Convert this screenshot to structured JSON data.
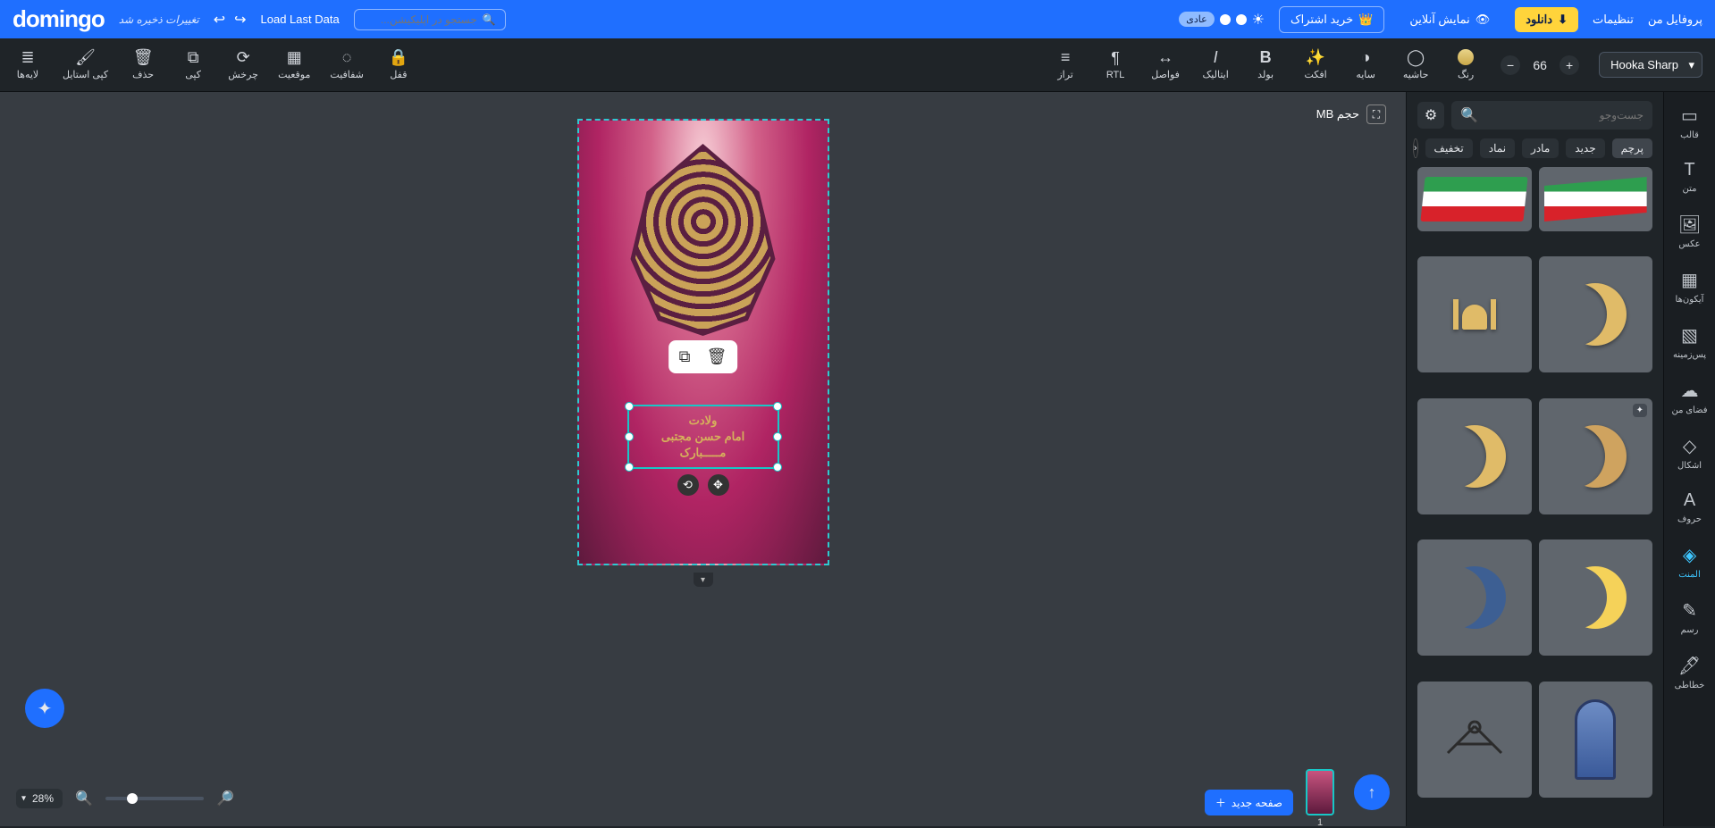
{
  "topbar": {
    "logo": "domingo",
    "profile": "پروفایل من",
    "settings": "تنظیمات",
    "download": "دانلود",
    "preview": "نمایش آنلاین",
    "subscribe": "خرید اشتراک",
    "mode_label": "عادی",
    "search_placeholder": "جستجو در اپلیکیشن...",
    "load_last": "Load Last Data",
    "save_status": "تغییرات ذخیره شد"
  },
  "toolbar": {
    "layers": "لایه‌ها",
    "copy_style": "کپی استایل",
    "delete": "حذف",
    "copy": "کپی",
    "rotate": "چرخش",
    "position": "موقعیت",
    "opacity": "شفافیت",
    "lock": "قفل",
    "align": "تراز",
    "rtl": "RTL",
    "spacing": "فواصل",
    "italic": "ایتالیک",
    "bold": "بولد",
    "effect": "افکت",
    "shadow": "سایه",
    "border": "حاشیه",
    "color": "رنگ",
    "font_name": "Hooka Sharp",
    "font_size": "66"
  },
  "canvas": {
    "badge": "MB حجم",
    "text_lines": [
      "ولادت",
      "امام حسن مجتبی",
      "مـــــبارک"
    ]
  },
  "asset_panel": {
    "search_placeholder": "جست‌وجو",
    "chips": [
      "پرچم",
      "جدید",
      "مادر",
      "نماد",
      "تخفیف"
    ]
  },
  "right_rail": {
    "items": [
      {
        "label": "قالب"
      },
      {
        "label": "متن"
      },
      {
        "label": "عکس"
      },
      {
        "label": "آیکون‌ها"
      },
      {
        "label": "پس‌زمینه"
      },
      {
        "label": "فضای من"
      },
      {
        "label": "اشکال"
      },
      {
        "label": "حروف"
      },
      {
        "label": "المنت"
      },
      {
        "label": "رسم"
      },
      {
        "label": "خطاطی"
      }
    ],
    "active_index": 8
  },
  "pages": {
    "new_page": "صفحه جدید",
    "current_number": "1"
  },
  "zoom": {
    "value": "28%"
  }
}
